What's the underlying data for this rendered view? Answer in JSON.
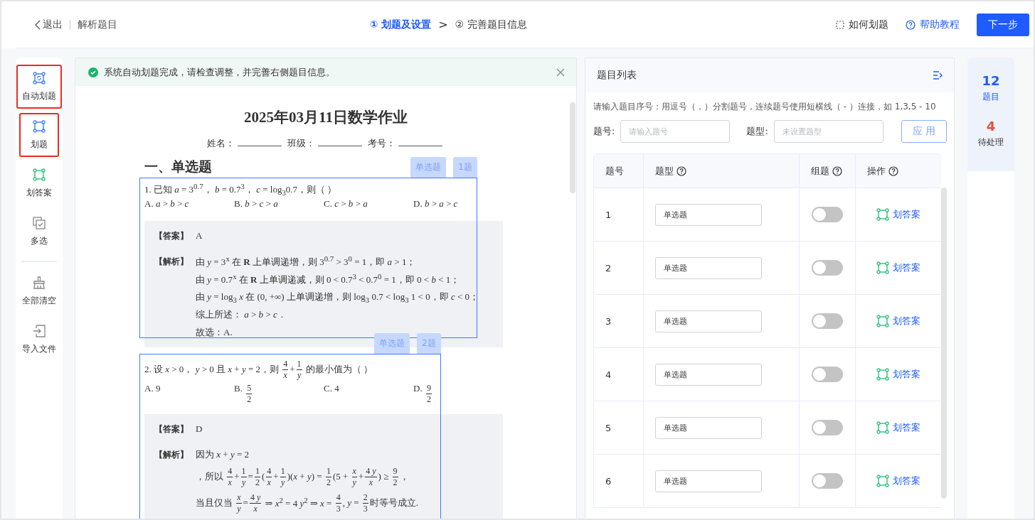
{
  "topbar": {
    "back": "退出",
    "title": "解析题目",
    "steps": [
      {
        "number": "①",
        "label": "划题及设置",
        "selected": true
      },
      {
        "number": "②",
        "label": "完善题目信息",
        "selected": false
      }
    ],
    "step_separator": ">",
    "how_to": "如何划题",
    "help": "帮助教程",
    "next": "下一步"
  },
  "tools": [
    {
      "kind": "auto",
      "label": "自动划题",
      "highlighted": true
    },
    {
      "kind": "mark",
      "label": "划题",
      "highlighted": true
    },
    {
      "kind": "answer",
      "label": "划答案",
      "highlighted": false
    },
    {
      "kind": "multi",
      "label": "多选",
      "highlighted": false
    },
    {
      "kind": "divider"
    },
    {
      "kind": "clear",
      "label": "全部清空",
      "highlighted": false
    },
    {
      "kind": "import",
      "label": "导入文件",
      "highlighted": false
    }
  ],
  "notice": "系统自动划题完成，请检查调整，并完善右侧题目信息。",
  "document": {
    "title": "2025年03月11日数学作业",
    "info_fields": [
      "姓名：",
      "班级：",
      "考号："
    ],
    "section": "一、单选题",
    "questions": [
      {
        "tags": [
          "单选题",
          "1题"
        ],
        "stem": [
          "1. 已知 *a* = 3$^{0.7}$， *b* = 0.7$^{3}$， *c* = log$_{3}$0.7，则（ ）"
        ],
        "options": [
          [
            "A. *a* > *b* > *c*"
          ],
          [
            "B. *b* > *c* > *a*"
          ],
          [
            "C. *c* > *b* > *a*"
          ],
          [
            "D. *b* > *a* > *c*"
          ]
        ],
        "answer_label": "【答案】",
        "answer": "A",
        "analysis_label": "【解析】",
        "analysis": [
          [
            "由 *y* = 3$^{x}$ 在 **R** 上单调递增，则 3$^{0.7}$ > 3$^{0}$ = 1，即 *a* > 1；"
          ],
          [
            "由 *y* = 0.7$^{x}$ 在 **R** 上单调递减，则 0 < 0.7$^{3}$ < 0.7$^{0}$ = 1，即 0 < *b* < 1；"
          ],
          [
            "由 *y* = log$_{3}$ *x* 在 (0, +∞) 上单调递增，则 log$_{3}$ 0.7 < log$_{3}$ 1 < 0，即 *c* < 0；"
          ],
          [
            "综上所述： *a* > *b* > *c*．"
          ],
          [
            "故选：A."
          ]
        ]
      },
      {
        "tags": [
          "单选题",
          "2题"
        ],
        "stem": [
          "2. 设 *x* > 0， *y* > 0 且 *x* + *y* = 2，则 ",
          {
            "num": "4",
            "den": "*x*"
          },
          "+",
          {
            "num": "1",
            "den": "*y*"
          },
          " 的最小值为（ ）"
        ],
        "options": [
          [
            "A. 9"
          ],
          [
            "B. ",
            {
              "num": "5",
              "den": "2"
            }
          ],
          [
            "C. 4"
          ],
          [
            "D. ",
            {
              "num": "9",
              "den": "2"
            }
          ]
        ],
        "answer_label": "【答案】",
        "answer": "D",
        "analysis_label": "【解析】",
        "analysis": [
          [
            "因为 *x* + *y* = 2"
          ],
          [
            "，所以 ",
            {
              "num": "4",
              "den": "*x*"
            },
            "+",
            {
              "num": "1",
              "den": "*y*"
            },
            "=",
            {
              "num": "1",
              "den": "2"
            },
            "(",
            {
              "num": "4",
              "den": "*x*"
            },
            "+",
            {
              "num": "1",
              "den": "*y*"
            },
            ")(*x* + *y*) = ",
            {
              "num": "1",
              "den": "2"
            },
            "(5 + ",
            {
              "num": "*x*",
              "den": "*y*"
            },
            "+",
            {
              "num": "4 *y*",
              "den": "*x*"
            },
            ") ≥ ",
            {
              "num": "9",
              "den": "2"
            },
            "，"
          ],
          [
            "当且仅当 ",
            {
              "num": "*x*",
              "den": "*y*"
            },
            "=",
            {
              "num": "4 *y*",
              "den": "*x*"
            },
            " ⇒ *x*$^{2}$ = 4 *y*$^{2}$ ⇒ *x* = ",
            {
              "num": "4",
              "den": "3"
            },
            ", *y* = ",
            {
              "num": "2",
              "den": "3"
            },
            "时等号成立."
          ]
        ]
      }
    ]
  },
  "question_list": {
    "title": "题目列表",
    "hint": "请输入题目序号：用逗号（，）分割题号，连续题号使用短横线（ - ）连接，如 1,3,5 - 10",
    "number_label": "题号:",
    "number_placeholder": "请输入题号",
    "type_label": "题型:",
    "type_placeholder": "未设置题型",
    "apply": "应 用",
    "columns": [
      {
        "label": "题号",
        "help": false
      },
      {
        "label": "题型",
        "help": true
      },
      {
        "label": "组题",
        "help": true
      },
      {
        "label": "操作",
        "help": true
      }
    ],
    "rows": [
      {
        "number": "1",
        "type": "单选题",
        "grouped": false,
        "action": "划答案"
      },
      {
        "number": "2",
        "type": "单选题",
        "grouped": false,
        "action": "划答案"
      },
      {
        "number": "3",
        "type": "单选题",
        "grouped": false,
        "action": "划答案"
      },
      {
        "number": "4",
        "type": "单选题",
        "grouped": false,
        "action": "划答案"
      },
      {
        "number": "5",
        "type": "单选题",
        "grouped": false,
        "action": "划答案"
      },
      {
        "number": "6",
        "type": "单选题",
        "grouped": false,
        "action": "划答案"
      }
    ]
  },
  "stats": [
    {
      "value": "12",
      "label": "题目",
      "color": "#1f5cff"
    },
    {
      "value": "4",
      "label": "待处理",
      "color": "#e5533d"
    }
  ]
}
